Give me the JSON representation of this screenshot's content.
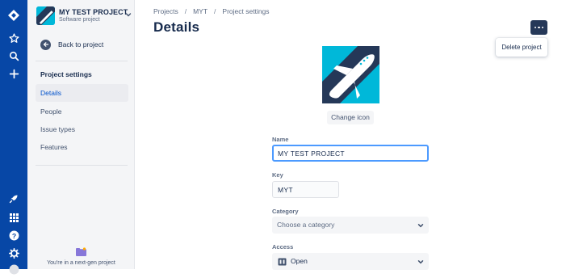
{
  "project": {
    "name": "MY TEST PROJECT",
    "type": "Software project"
  },
  "sidebar": {
    "back_label": "Back to project",
    "section_title": "Project settings",
    "items": [
      {
        "label": "Details",
        "active": true
      },
      {
        "label": "People",
        "active": false
      },
      {
        "label": "Issue types",
        "active": false
      },
      {
        "label": "Features",
        "active": false
      }
    ],
    "footer_text": "You're in a next-gen project"
  },
  "breadcrumbs": [
    "Projects",
    "MYT",
    "Project settings"
  ],
  "page_title": "Details",
  "actions": {
    "more_icon": "ellipsis-icon",
    "delete_label": "Delete project"
  },
  "change_icon_label": "Change icon",
  "form": {
    "name_label": "Name",
    "name_value": "MY TEST PROJECT",
    "key_label": "Key",
    "key_value": "MYT",
    "category_label": "Category",
    "category_placeholder": "Choose a category",
    "access_label": "Access",
    "access_value": "Open"
  },
  "colors": {
    "global_nav": "#0747a6",
    "active_text": "#0052cc",
    "focus_border": "#4c9aff",
    "primary_dark": "#253858"
  }
}
